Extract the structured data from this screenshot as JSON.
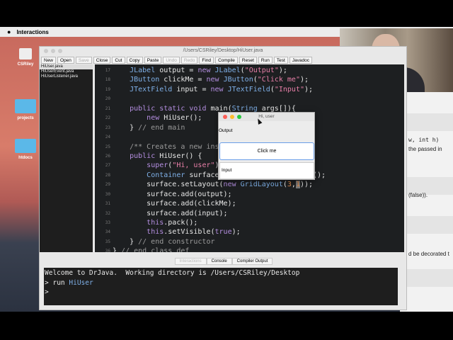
{
  "menubar": {
    "app": "Interactions"
  },
  "desktop": {
    "icons": [
      "CSRiley",
      "projects",
      "htdocs"
    ]
  },
  "window": {
    "title": "/Users/CSRiley/Desktop/HiUser.java"
  },
  "toolbar": [
    {
      "label": "New",
      "enabled": true
    },
    {
      "label": "Open",
      "enabled": true
    },
    {
      "label": "Save",
      "enabled": false
    },
    {
      "label": "Close",
      "enabled": true
    },
    {
      "label": "Cut",
      "enabled": true
    },
    {
      "label": "Copy",
      "enabled": true
    },
    {
      "label": "Paste",
      "enabled": true
    },
    {
      "label": "Undo",
      "enabled": false
    },
    {
      "label": "Redo",
      "enabled": false
    },
    {
      "label": "Find",
      "enabled": true
    },
    {
      "label": "Compile",
      "enabled": true
    },
    {
      "label": "Reset",
      "enabled": true
    },
    {
      "label": "Run",
      "enabled": true
    },
    {
      "label": "Test",
      "enabled": true
    },
    {
      "label": "Javadoc",
      "enabled": true
    }
  ],
  "files": [
    "HiUser.java",
    "HiUserEvent.java",
    "HiUserListener.java"
  ],
  "code": [
    {
      "n": "17",
      "t": [
        [
          "    "
        ],
        [
          "JLabel",
          "ty"
        ],
        [
          " output = "
        ],
        [
          "new",
          "kw"
        ],
        [
          " "
        ],
        [
          "JLabel",
          "ty"
        ],
        [
          "("
        ],
        [
          "\"Output\"",
          "st"
        ],
        [
          ");"
        ]
      ]
    },
    {
      "n": "18",
      "t": [
        [
          "    "
        ],
        [
          "JButton",
          "ty"
        ],
        [
          " clickMe = "
        ],
        [
          "new",
          "kw"
        ],
        [
          " "
        ],
        [
          "JButton",
          "ty"
        ],
        [
          "("
        ],
        [
          "\"Click me\"",
          "st"
        ],
        [
          ");"
        ]
      ]
    },
    {
      "n": "19",
      "t": [
        [
          "    "
        ],
        [
          "JTextField",
          "ty"
        ],
        [
          " input = "
        ],
        [
          "new",
          "kw"
        ],
        [
          " "
        ],
        [
          "JTextField",
          "ty"
        ],
        [
          "("
        ],
        [
          "\"Input\"",
          "st"
        ],
        [
          ");"
        ]
      ]
    },
    {
      "n": "20",
      "t": []
    },
    {
      "n": "21",
      "t": [
        [
          "    "
        ],
        [
          "public static void",
          "kw"
        ],
        [
          " main("
        ],
        [
          "String",
          "ty"
        ],
        [
          " args[]){"
        ]
      ]
    },
    {
      "n": "22",
      "t": [
        [
          "        "
        ],
        [
          "new",
          "kw"
        ],
        [
          " HiUser();"
        ]
      ]
    },
    {
      "n": "23",
      "t": [
        [
          "    } "
        ],
        [
          "// end main",
          "cm"
        ]
      ]
    },
    {
      "n": "24",
      "t": []
    },
    {
      "n": "25",
      "t": [
        [
          "    "
        ],
        [
          "/** Creates a new instance",
          "cm"
        ]
      ]
    },
    {
      "n": "26",
      "t": [
        [
          "    "
        ],
        [
          "public",
          "kw"
        ],
        [
          " HiUser() {"
        ]
      ]
    },
    {
      "n": "27",
      "t": [
        [
          "        "
        ],
        [
          "super",
          "kw"
        ],
        [
          "("
        ],
        [
          "\"Hi, user\"",
          "st"
        ],
        [
          ");"
        ]
      ]
    },
    {
      "n": "28",
      "t": [
        [
          "        "
        ],
        [
          "Container",
          "ty"
        ],
        [
          " surface = this.getContentPane();"
        ]
      ]
    },
    {
      "n": "29",
      "t": [
        [
          "        surface.setLayout("
        ],
        [
          "new",
          "kw"
        ],
        [
          " "
        ],
        [
          "GridLayout",
          "ty"
        ],
        [
          "("
        ],
        [
          "3",
          "nu"
        ],
        [
          ","
        ],
        [
          "1",
          "nu sel"
        ],
        [
          "));"
        ]
      ]
    },
    {
      "n": "30",
      "t": [
        [
          "        surface.add(output);"
        ]
      ]
    },
    {
      "n": "31",
      "t": [
        [
          "        surface.add(clickMe);"
        ]
      ]
    },
    {
      "n": "32",
      "t": [
        [
          "        surface.add(input);"
        ]
      ]
    },
    {
      "n": "33",
      "t": [
        [
          "        "
        ],
        [
          "this",
          "kw"
        ],
        [
          ".pack();"
        ]
      ]
    },
    {
      "n": "34",
      "t": [
        [
          "        "
        ],
        [
          "this",
          "kw"
        ],
        [
          ".setVisible("
        ],
        [
          "true",
          "kw"
        ],
        [
          ");"
        ]
      ]
    },
    {
      "n": "35",
      "t": [
        [
          "    } "
        ],
        [
          "// end constructor",
          "cm"
        ]
      ]
    },
    {
      "n": "36",
      "t": [
        [
          "} "
        ],
        [
          "// end class def",
          "cm"
        ]
      ]
    }
  ],
  "tabs": [
    "Interactions",
    "Console",
    "Compiler Output"
  ],
  "console": {
    "welcome": "Welcome to DrJava.  Working directory is /Users/CSRiley/Desktop",
    "prompt": ">",
    "cmd": "run",
    "arg": "HiUser"
  },
  "dialog": {
    "title": "Hi, user",
    "label": "Output",
    "button": "Click me",
    "input": "Input"
  },
  "browser": {
    "lines": [
      "w, int h)",
      "the passed in",
      "(false)).",
      "d be decorated t"
    ]
  }
}
